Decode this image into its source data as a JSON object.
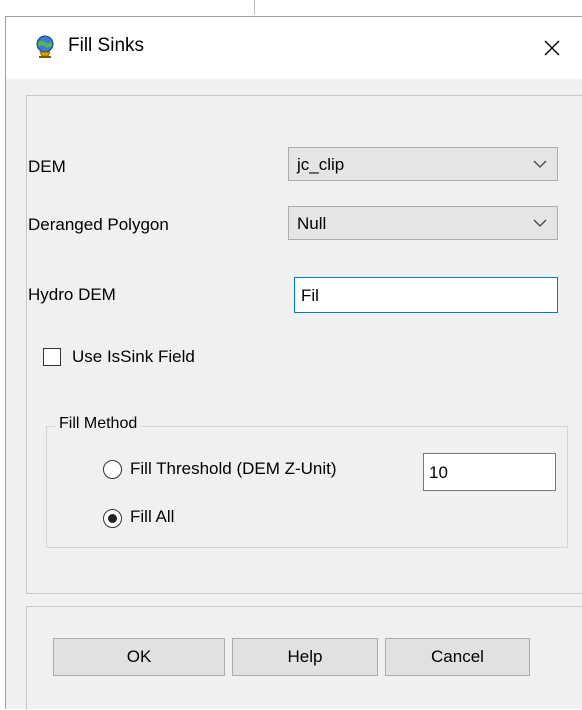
{
  "window": {
    "title": "Fill Sinks",
    "close_symbol": "✕",
    "icon": "globe-tool-icon"
  },
  "fields": {
    "dem": {
      "label": "DEM",
      "value": "jc_clip"
    },
    "deranged_polygon": {
      "label": "Deranged Polygon",
      "value": "Null"
    },
    "hydro_dem": {
      "label": "Hydro DEM",
      "value": "Fil"
    }
  },
  "use_issink": {
    "label": "Use IsSink Field",
    "checked": false
  },
  "fill_method": {
    "title": "Fill Method",
    "options": [
      {
        "label": "Fill Threshold (DEM Z-Unit)",
        "selected": false
      },
      {
        "label": "Fill All",
        "selected": true
      }
    ],
    "threshold_value": "10"
  },
  "buttons": {
    "ok": "OK",
    "help": "Help",
    "cancel": "Cancel"
  },
  "colors": {
    "focus_border": "#0078d7",
    "dialog_bg": "#f0f0f0"
  }
}
